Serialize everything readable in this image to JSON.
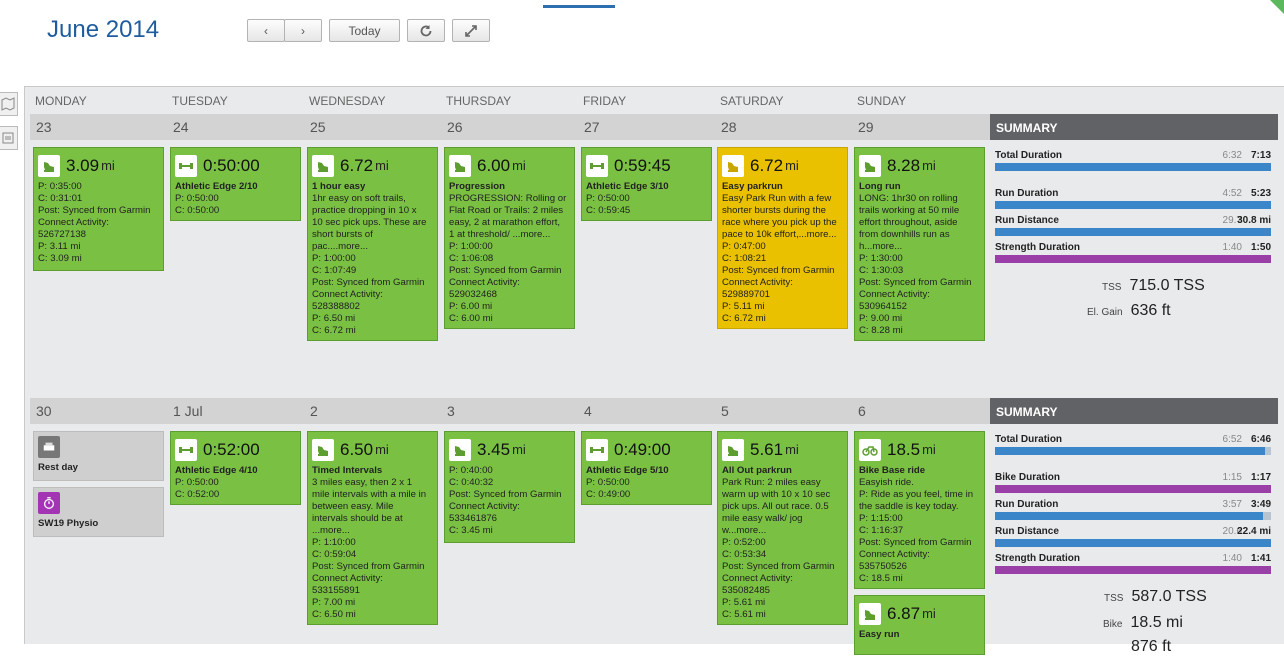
{
  "header": {
    "month": "June",
    "year": "2014",
    "prev": "‹",
    "next": "›",
    "today": "Today"
  },
  "days": [
    "MONDAY",
    "TUESDAY",
    "WEDNESDAY",
    "THURSDAY",
    "FRIDAY",
    "SATURDAY",
    "SUNDAY"
  ],
  "week1": {
    "dates": [
      "23",
      "24",
      "25",
      "26",
      "27",
      "28",
      "29"
    ],
    "summary": {
      "title": "SUMMARY",
      "rows": [
        {
          "label": "Total Duration",
          "planned": "6:32",
          "completed": "7:13",
          "pct": 1.0,
          "color": "#3a86c8"
        },
        {
          "label": "Run Duration",
          "planned": "4:52",
          "completed": "5:23",
          "pct": 1.0,
          "color": "#3a86c8"
        },
        {
          "label": "Run Distance",
          "planned": "29.7",
          "completed": "30.8 mi",
          "pct": 1.0,
          "color": "#3a86c8"
        },
        {
          "label": "Strength Duration",
          "planned": "1:40",
          "completed": "1:50",
          "pct": 1.0,
          "color": "#9b3fa8"
        }
      ],
      "tss_label": "TSS",
      "tss": "715.0 TSS",
      "elgain_label": "El. Gain",
      "elgain": "636 ft"
    }
  },
  "week2": {
    "dates": [
      "30",
      "1 Jul",
      "2",
      "3",
      "4",
      "5",
      "6"
    ],
    "summary": {
      "title": "SUMMARY",
      "rows": [
        {
          "label": "Total Duration",
          "planned": "6:52",
          "completed": "6:46",
          "pct": 0.98,
          "color": "#3a86c8"
        },
        {
          "label": "Bike Duration",
          "planned": "1:15",
          "completed": "1:17",
          "pct": 1.0,
          "color": "#9b3fa8"
        },
        {
          "label": "Run Duration",
          "planned": "3:57",
          "completed": "3:49",
          "pct": 0.97,
          "color": "#3a86c8"
        },
        {
          "label": "Run Distance",
          "planned": "20.6",
          "completed": "22.4 mi",
          "pct": 1.0,
          "color": "#3a86c8"
        },
        {
          "label": "Strength Duration",
          "planned": "1:40",
          "completed": "1:41",
          "pct": 1.0,
          "color": "#9b3fa8"
        }
      ],
      "tss_label": "TSS",
      "tss": "587.0 TSS",
      "bike_label": "Bike",
      "bike": "18.5 mi",
      "cut": "876 ft"
    }
  },
  "cards": {
    "w1mon": {
      "value": "3.09",
      "unit": "mi",
      "lines": [
        "P: 0:35:00",
        "C: 0:31:01",
        "Post: Synced from Garmin",
        "Connect Activity:",
        "526727138",
        "P: 3.11 mi",
        "C: 3.09 mi"
      ]
    },
    "w1tue": {
      "value": "0:50:00",
      "title": "Athletic Edge 2/10",
      "lines": [
        "P: 0:50:00",
        "C: 0:50:00"
      ]
    },
    "w1wed": {
      "value": "6.72",
      "unit": "mi",
      "title": "1 hour easy",
      "lines": [
        "1hr easy on soft trails,",
        "practice dropping in 10 x",
        "10 sec pick ups. These are",
        "short bursts of",
        "pac....more...",
        "P: 1:00:00",
        "C: 1:07:49",
        "Post: Synced from Garmin",
        "Connect Activity:",
        "528388802",
        "P: 6.50 mi",
        "C: 6.72 mi"
      ]
    },
    "w1thu": {
      "value": "6.00",
      "unit": "mi",
      "title": "Progression",
      "lines": [
        "PROGRESSION: Rolling or",
        "Flat Road or Trails: 2 miles",
        "easy, 2 at marathon effort,",
        "1 at threshold/ ...more...",
        "P: 1:00:00",
        "C: 1:06:08",
        "Post: Synced from Garmin",
        "Connect Activity:",
        "529032468",
        "P: 6.00 mi",
        "C: 6.00 mi"
      ]
    },
    "w1fri": {
      "value": "0:59:45",
      "title": "Athletic Edge 3/10",
      "lines": [
        "P: 0:50:00",
        "C: 0:59:45"
      ]
    },
    "w1sat": {
      "value": "6.72",
      "unit": "mi",
      "title": "Easy parkrun",
      "lines": [
        "Easy Park Run with a few",
        "shorter bursts during the",
        "race where you pick up the",
        "pace to 10k effort,...more...",
        "P: 0:47:00",
        "C: 1:08:21",
        "Post: Synced from Garmin",
        "Connect Activity:",
        "529889701",
        "P: 5.11 mi",
        "C: 6.72 mi"
      ]
    },
    "w1sun": {
      "value": "8.28",
      "unit": "mi",
      "title": "Long run",
      "lines": [
        "LONG: 1hr30 on rolling",
        "trails working at 50 mile",
        "effort throughout, aside",
        "from downhills run as",
        "h...more...",
        "P: 1:30:00",
        "C: 1:30:03",
        "Post: Synced from Garmin",
        "Connect Activity:",
        "530964152",
        "P: 9.00 mi",
        "C: 8.28 mi"
      ]
    },
    "w2mon_a": {
      "title": "Rest day"
    },
    "w2mon_b": {
      "title": "SW19 Physio"
    },
    "w2tue": {
      "value": "0:52:00",
      "title": "Athletic Edge 4/10",
      "lines": [
        "P: 0:50:00",
        "C: 0:52:00"
      ]
    },
    "w2wed": {
      "value": "6.50",
      "unit": "mi",
      "title": "Timed Intervals",
      "lines": [
        "3 miles easy, then 2 x 1",
        "mile intervals with a mile in",
        "between easy. Mile",
        "intervals should be at",
        "...more...",
        "P: 1:10:00",
        "C: 0:59:04",
        "Post: Synced from Garmin",
        "Connect Activity:",
        "533155891",
        "P: 7.00 mi",
        "C: 6.50 mi"
      ]
    },
    "w2thu": {
      "value": "3.45",
      "unit": "mi",
      "lines": [
        "P: 0:40:00",
        "C: 0:40:32",
        "Post: Synced from Garmin",
        "Connect Activity:",
        "533461876",
        "C: 3.45 mi"
      ]
    },
    "w2fri": {
      "value": "0:49:00",
      "title": "Athletic Edge 5/10",
      "lines": [
        "P: 0:50:00",
        "C: 0:49:00"
      ]
    },
    "w2sat": {
      "value": "5.61",
      "unit": "mi",
      "title": "All Out parkrun",
      "lines": [
        "Park Run: 2 miles easy",
        "warm up with 10 x 10 sec",
        "pick ups. All out race. 0.5",
        "mile easy walk/ jog",
        "w...more...",
        "P: 0:52:00",
        "C: 0:53:34",
        "Post: Synced from Garmin",
        "Connect Activity:",
        "535082485",
        "P: 5.61 mi",
        "C: 5.61 mi"
      ]
    },
    "w2sun_a": {
      "value": "18.5",
      "unit": "mi",
      "title": "Bike Base ride",
      "lines": [
        "Easyish ride.",
        "P: Ride as you feel, time in",
        "the saddle is key today.",
        "P: 1:15:00",
        "C: 1:16:37",
        "Post: Synced from Garmin",
        "Connect Activity:",
        "535750526",
        "C: 18.5 mi"
      ]
    },
    "w2sun_b": {
      "value": "6.87",
      "unit": "mi",
      "title": "Easy run"
    }
  }
}
